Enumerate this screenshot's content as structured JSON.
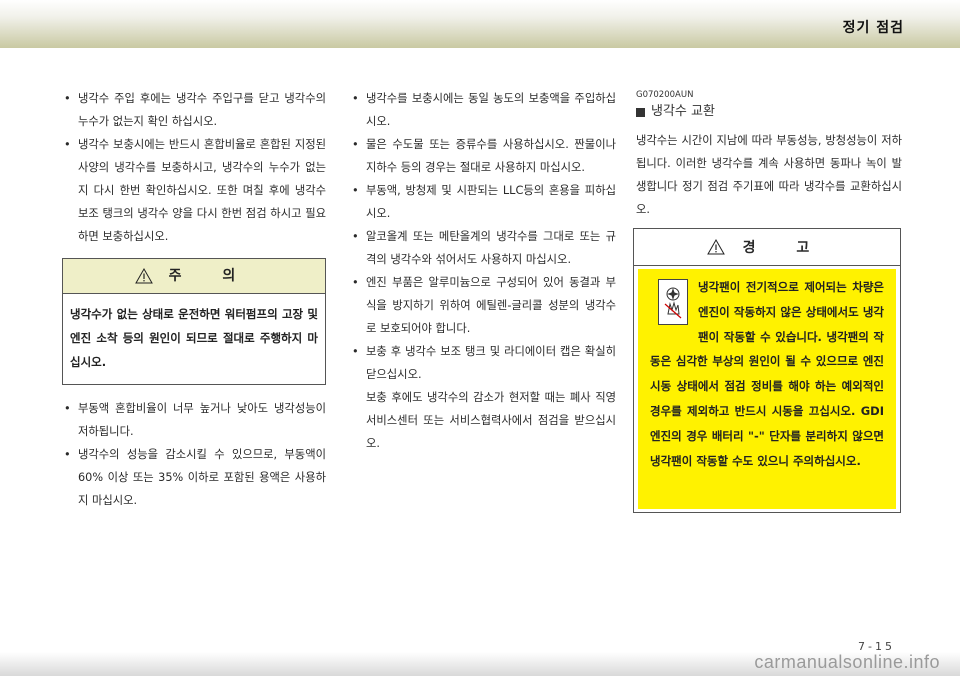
{
  "header": {
    "section_title": "정기 점검"
  },
  "left_column": {
    "bullets_top": [
      "냉각수 주입 후에는 냉각수 주입구를 닫고 냉각수의 누수가 없는지 확인 하십시오.",
      "냉각수 보충시에는 반드시 혼합비율로 혼합된 지정된 사양의 냉각수를 보충하시고, 냉각수의 누수가 없는지 다시 한번 확인하십시오. 또한 며칠 후에 냉각수 보조 탱크의 냉각수 양을 다시 한번 점검 하시고 필요하면 보충하십시오."
    ],
    "caution": {
      "title": "주 의",
      "text": "냉각수가 없는 상태로 운전하면 워터펌프의 고장 및 엔진 소착 등의 원인이 되므로 절대로 주행하지 마십시오."
    },
    "bullets_bottom": [
      "부동액 혼합비율이 너무 높거나 낮아도 냉각성능이 저하됩니다.",
      "냉각수의 성능을 감소시킬 수 있으므로, 부동액이 60% 이상 또는 35% 이하로 포함된 용액은 사용하지 마십시오."
    ]
  },
  "middle_column": {
    "bullets": [
      "냉각수를 보충시에는 동일 농도의 보충액을 주입하십시오.",
      "물은 수도물 또는 증류수를 사용하십시오. 짠물이나 지하수 등의 경우는 절대로 사용하지 마십시오.",
      "부동액, 방청제 및 시판되는 LLC등의 혼용을 피하십시오.",
      "알코올계 또는 메탄올계의 냉각수를 그대로 또는 규격의 냉각수와 섞어서도 사용하지 마십시오.",
      "엔진 부품은 알루미늄으로 구성되어 있어 동결과 부식을 방지하기 위하여 에틸렌-글리콜 성분의 냉각수로 보호되어야 합니다.",
      "보충 후 냉각수 보조 탱크 및 라디에이터 캡은 확실히 닫으십시오."
    ],
    "after_note": "보충 후에도 냉각수의 감소가 현저할 때는 폐사 직영 서비스센터 또는 서비스협력사에서 점검을 받으십시오."
  },
  "right_column": {
    "code": "G070200AUN",
    "section_heading": "냉각수 교환",
    "paragraph": "냉각수는 시간이 지남에 따라 부동성능, 방청성능이 저하됩니다. 이러한 냉각수를 계속 사용하면 동파나 녹이 발생합니다 정기 점검 주기표에 따라 냉각수를 교환하십시오.",
    "warning": {
      "title": "경 고",
      "text": "냉각팬이 전기적으로 제어되는 차량은 엔진이 작동하지 않은 상태에서도 냉각팬이 작동할 수 있습니다. 냉각팬의 작동은 심각한 부상의 원인이 될 수 있으므로 엔진 시동 상태에서 점검 정비를 해야 하는 예외적인 경우를 제외하고 반드시 시동을 끄십시오. GDI 엔진의 경우 배터리 \"-\" 단자를 분리하지 않으면 냉각팬이 작동할 수도 있으니 주의하십시오."
    }
  },
  "footer": {
    "page_number": "7-15",
    "watermark": "carmanualsonline.info"
  }
}
